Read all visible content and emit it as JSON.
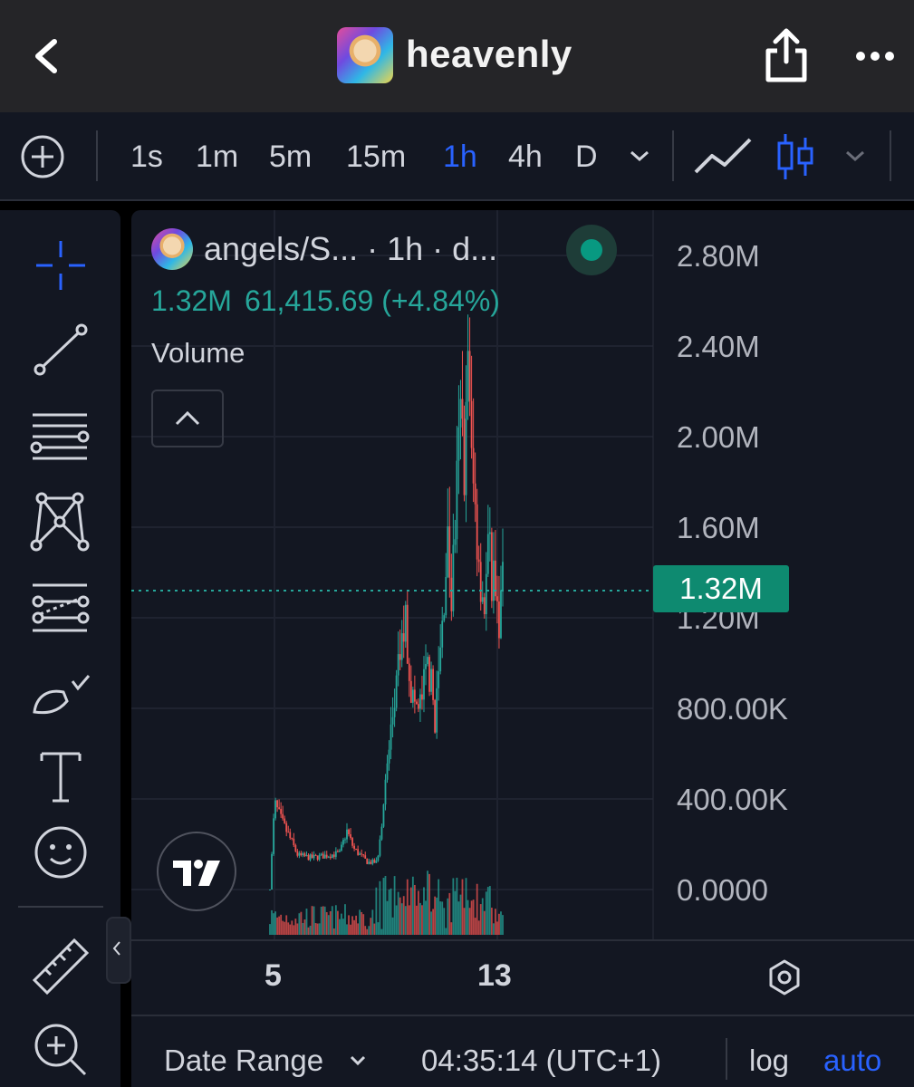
{
  "header": {
    "title": "heavenly",
    "back_icon": "chevron-left-icon",
    "share_icon": "share-icon",
    "more_icon": "more-horizontal-icon"
  },
  "toolbar": {
    "timeframes": [
      "1s",
      "1m",
      "5m",
      "15m",
      "1h",
      "4h",
      "D"
    ],
    "active_timeframe": "1h"
  },
  "sidebar": {
    "tools": [
      "crosshair-icon",
      "trend-line-icon",
      "fib-retracement-icon",
      "pattern-icon",
      "prediction-icon",
      "brush-icon",
      "text-icon",
      "emoji-icon",
      "ruler-icon",
      "zoom-in-icon"
    ]
  },
  "chart": {
    "legend": {
      "title": "angels/S... · 1h · d...",
      "value": "1.32M",
      "change": "61,415.69 (+4.84%)",
      "indicator": "Volume"
    },
    "price_axis": [
      "2.80M",
      "2.40M",
      "2.00M",
      "1.60M",
      "1.20M",
      "800.00K",
      "400.00K",
      "0.0000"
    ],
    "current_price": "1.32M",
    "time_axis": [
      "5",
      "13"
    ],
    "colors": {
      "up": "#26a69a",
      "down": "#ef5350",
      "accent": "#2962ff",
      "background": "#131722"
    }
  },
  "chart_data": {
    "type": "candlestick",
    "ylim": [
      0,
      2800000
    ],
    "y_ticks": [
      0,
      400000,
      800000,
      1200000,
      1600000,
      2000000,
      2400000,
      2800000
    ],
    "x_ticks": [
      "5",
      "13"
    ],
    "timeframe": "1h",
    "last_value": 1320000,
    "series_close_path": [
      [
        0,
        0
      ],
      [
        0.02,
        380000
      ],
      [
        0.05,
        300000
      ],
      [
        0.08,
        240000
      ],
      [
        0.12,
        150000
      ],
      [
        0.18,
        140000
      ],
      [
        0.24,
        150000
      ],
      [
        0.3,
        160000
      ],
      [
        0.33,
        260000
      ],
      [
        0.36,
        180000
      ],
      [
        0.42,
        120000
      ],
      [
        0.46,
        120000
      ],
      [
        0.48,
        300000
      ],
      [
        0.52,
        700000
      ],
      [
        0.55,
        950000
      ],
      [
        0.58,
        1200000
      ],
      [
        0.61,
        850000
      ],
      [
        0.64,
        780000
      ],
      [
        0.68,
        1000000
      ],
      [
        0.71,
        750000
      ],
      [
        0.74,
        1150000
      ],
      [
        0.76,
        1550000
      ],
      [
        0.78,
        1300000
      ],
      [
        0.8,
        1700000
      ],
      [
        0.82,
        2100000
      ],
      [
        0.84,
        1850000
      ],
      [
        0.85,
        2550000
      ],
      [
        0.86,
        1950000
      ],
      [
        0.88,
        1700000
      ],
      [
        0.9,
        1450000
      ],
      [
        0.92,
        1250000
      ],
      [
        0.94,
        1500000
      ],
      [
        0.96,
        1350000
      ],
      [
        0.98,
        1200000
      ],
      [
        1.0,
        1320000
      ]
    ]
  },
  "bottom_bar": {
    "date_range": "Date Range",
    "clock": "04:35:14 (UTC+1)",
    "log": "log",
    "auto": "auto"
  }
}
